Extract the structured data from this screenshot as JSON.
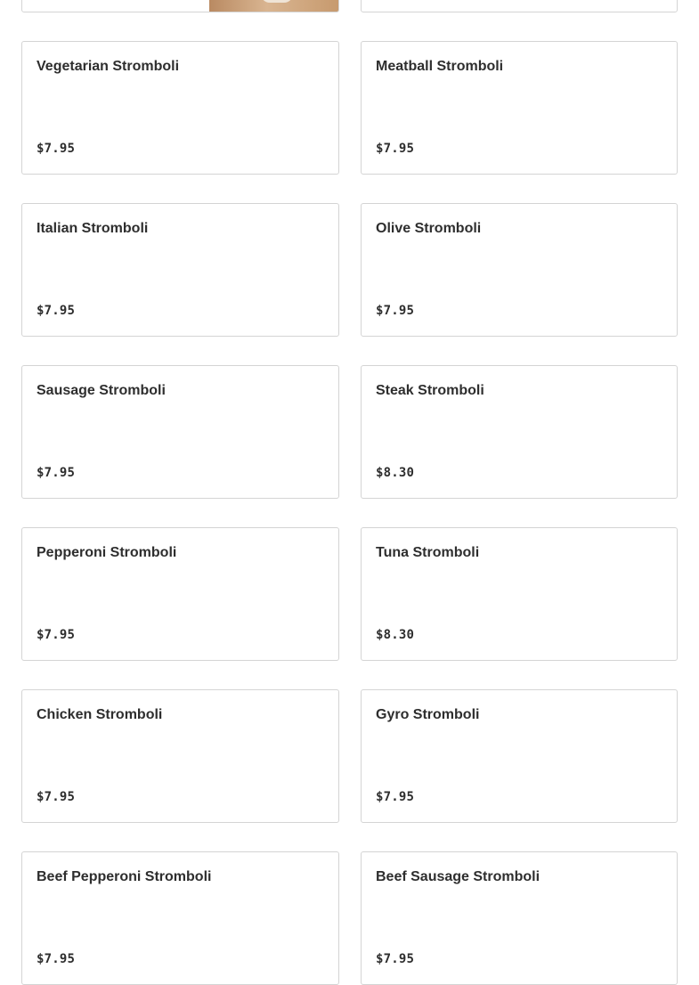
{
  "menu_items": [
    {
      "name": "Vegetarian Stromboli",
      "price": "$7.95"
    },
    {
      "name": "Meatball Stromboli",
      "price": "$7.95"
    },
    {
      "name": "Italian Stromboli",
      "price": "$7.95"
    },
    {
      "name": "Olive Stromboli",
      "price": "$7.95"
    },
    {
      "name": "Sausage Stromboli",
      "price": "$7.95"
    },
    {
      "name": "Steak Stromboli",
      "price": "$8.30"
    },
    {
      "name": "Pepperoni Stromboli",
      "price": "$7.95"
    },
    {
      "name": "Tuna Stromboli",
      "price": "$8.30"
    },
    {
      "name": "Chicken Stromboli",
      "price": "$7.95"
    },
    {
      "name": "Gyro Stromboli",
      "price": "$7.95"
    },
    {
      "name": "Beef Pepperoni Stromboli",
      "price": "$7.95"
    },
    {
      "name": "Beef Sausage Stromboli",
      "price": "$7.95"
    }
  ]
}
